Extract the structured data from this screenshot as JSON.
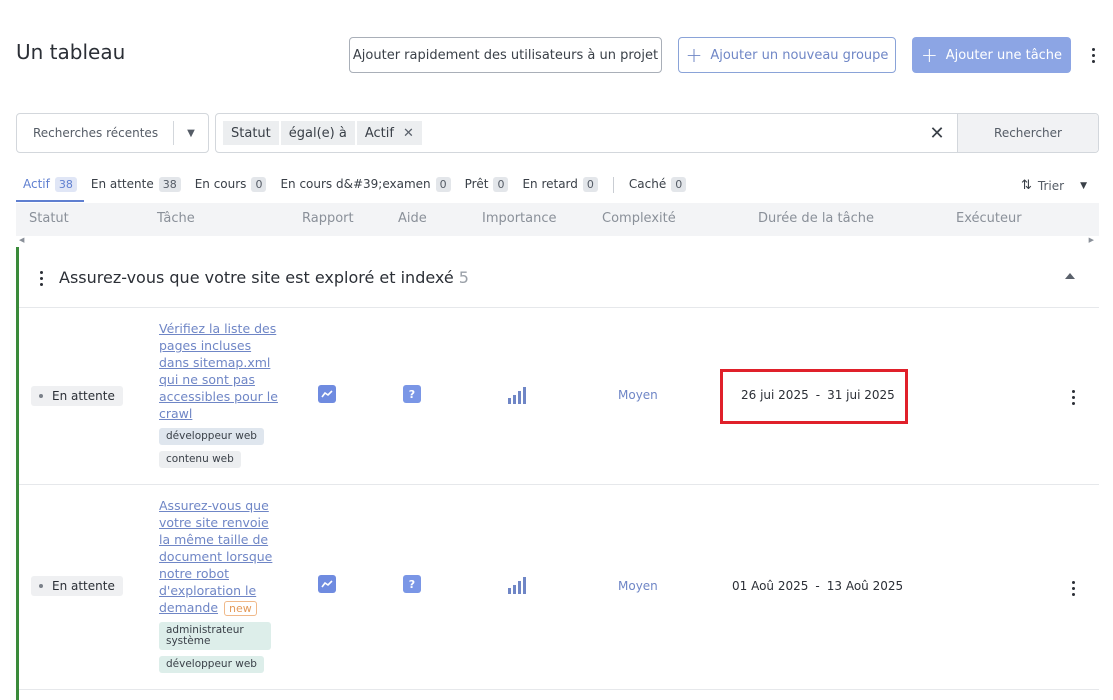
{
  "page": {
    "title": "Un tableau"
  },
  "toolbar": {
    "quick_add_users": "Ajouter rapidement des utilisateurs à un projet",
    "add_group": "Ajouter un nouveau groupe",
    "add_task": "Ajouter une tâche",
    "accent_color": "#8ca5e4"
  },
  "search": {
    "recent_label": "Recherches récentes",
    "filter_field": "Statut",
    "filter_operator": "égal(e) à",
    "filter_value": "Actif",
    "search_button": "Rechercher"
  },
  "tabs": [
    {
      "label": "Actif",
      "count": "38",
      "active": true
    },
    {
      "label": "En attente",
      "count": "38"
    },
    {
      "label": "En cours",
      "count": "0"
    },
    {
      "label": "En cours d&#39;examen",
      "count": "0"
    },
    {
      "label": "Prêt",
      "count": "0"
    },
    {
      "label": "En retard",
      "count": "0"
    },
    {
      "label": "Caché",
      "count": "0"
    }
  ],
  "sort": {
    "label": "Trier"
  },
  "columns": [
    "Statut",
    "Tâche",
    "Rapport",
    "Aide",
    "Importance",
    "Complexité",
    "Durée de la tâche",
    "Exécuteur"
  ],
  "group": {
    "title": "Assurez-vous que votre site est exploré et indexé",
    "count": "5",
    "color": "#3a8a3a"
  },
  "rows": [
    {
      "status": "En attente",
      "task": "Vérifiez la liste des pages incluses dans sitemap.xml qui ne sont pas accessibles pour le crawl",
      "tags": [
        "développeur web",
        "contenu web"
      ],
      "help": "?",
      "importance_level": 4,
      "complexity": "Moyen",
      "start": "26 jui 2025",
      "end": "31 jui 2025",
      "separator": "-"
    },
    {
      "status": "En attente",
      "task": "Assurez-vous que votre site renvoie la même taille de document lorsque notre robot d'exploration le demande",
      "new_badge": "new",
      "tags": [
        "administrateur système",
        "développeur web"
      ],
      "help": "?",
      "importance_level": 4,
      "complexity": "Moyen",
      "start": "01 Aoû 2025",
      "end": "13 Aoû 2025",
      "separator": "-"
    }
  ]
}
